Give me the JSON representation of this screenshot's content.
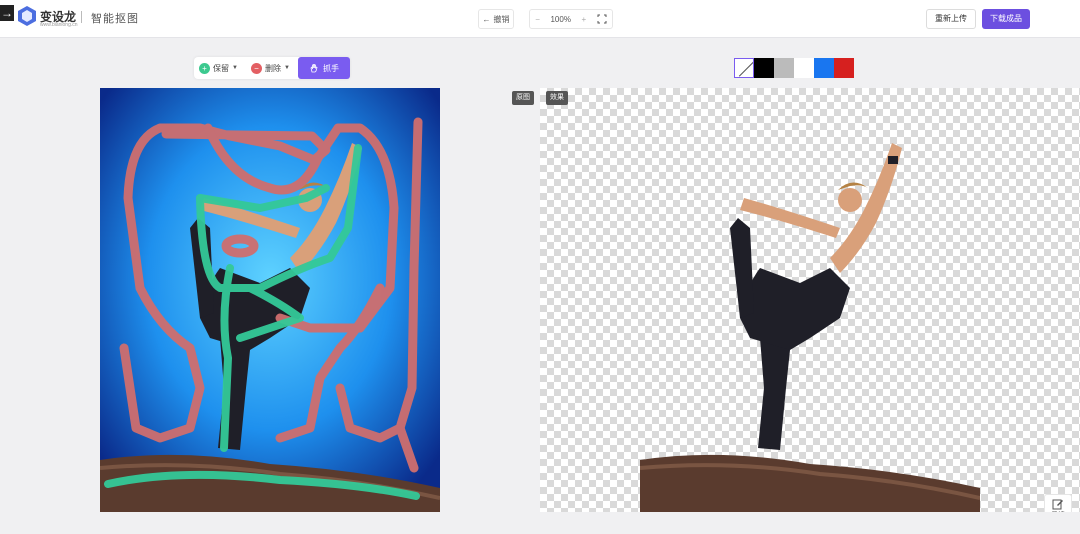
{
  "header": {
    "back_icon": "→",
    "brand": "变设龙",
    "brand_sub": "www.bianlong.cn",
    "page_title": "智能抠图",
    "undo_label": "撤销",
    "zoom_minus": "−",
    "zoom_value": "100%",
    "zoom_plus": "+",
    "reupload_label": "重新上传",
    "download_label": "下载成品"
  },
  "toolbar": {
    "keep_label": "保留",
    "erase_label": "删除",
    "hand_label": "抓手"
  },
  "background_swatches": [
    "transparent",
    "#000000",
    "#bbbbbb",
    "#ffffff",
    "#1976f0",
    "#d6201f"
  ],
  "tags": {
    "original": "原图",
    "result": "效果"
  },
  "feedback_label": "反馈",
  "colors": {
    "accent": "#6c4fe0",
    "keep": "#3cc98f",
    "erase": "#e35f63"
  }
}
